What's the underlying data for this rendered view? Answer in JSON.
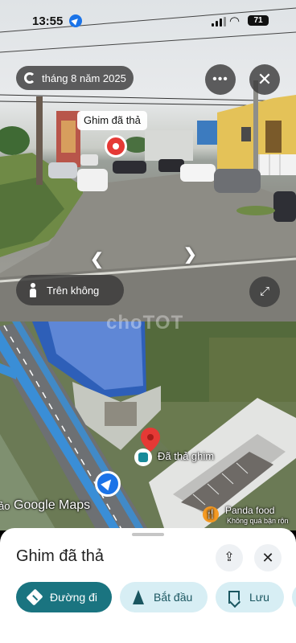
{
  "status_bar": {
    "time": "13:55",
    "battery": "71"
  },
  "street_view": {
    "date": "tháng 8 năm 2025",
    "pin_label": "Ghim đã thả",
    "aerial_label": "Trên không",
    "more_icon": "more-horiz-icon",
    "close_icon": "close-icon",
    "expand_icon": "expand-icon"
  },
  "map": {
    "dropped_pin_label": "Đã thả ghim",
    "poi_name": "Panda food",
    "poi_subtitle": "Không quá bận rộn",
    "attribution": "Google Maps",
    "left_partial_label": "ảo",
    "watermark": "choTOT"
  },
  "sheet": {
    "title": "Ghim đã thả",
    "actions": [
      {
        "label": "Đường đi",
        "icon": "directions-icon"
      },
      {
        "label": "Bắt đầu",
        "icon": "navigation-icon"
      },
      {
        "label": "Lưu",
        "icon": "bookmark-icon"
      }
    ]
  },
  "colors": {
    "primary": "#1a7480",
    "secondary": "#d7eef4",
    "pin": "#e53935",
    "location": "#1a73e8"
  }
}
